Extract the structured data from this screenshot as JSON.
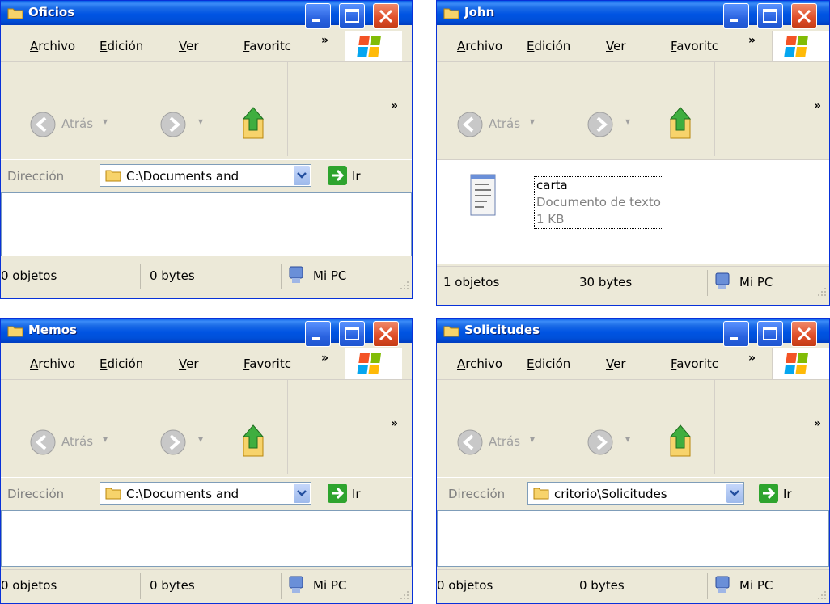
{
  "windows": [
    {
      "title": "Oficios",
      "menu": [
        "Archivo",
        "Edición",
        "Ver",
        "Favoritc"
      ],
      "menu_underline": [
        "A",
        "E",
        "V",
        "F"
      ],
      "back_label": "Atrás",
      "address_label": "Dirección",
      "address_value": "C:\\Documents and",
      "go_label": "Ir",
      "status_objects": "0 objetos",
      "status_bytes": "0 bytes",
      "status_location": "Mi PC",
      "files": []
    },
    {
      "title": "John",
      "menu": [
        "Archivo",
        "Edición",
        "Ver",
        "Favoritc"
      ],
      "menu_underline": [
        "A",
        "E",
        "V",
        "F"
      ],
      "back_label": "Atrás",
      "address_label": "",
      "address_value": "",
      "go_label": "",
      "status_objects": "1 objetos",
      "status_bytes": "30 bytes",
      "status_location": "Mi PC",
      "files": [
        {
          "name": "carta",
          "type": "Documento de texto",
          "size": "1 KB",
          "icon": "notepad-document-icon"
        }
      ]
    },
    {
      "title": "Memos",
      "menu": [
        "Archivo",
        "Edición",
        "Ver",
        "Favoritc"
      ],
      "menu_underline": [
        "A",
        "E",
        "V",
        "F"
      ],
      "back_label": "Atrás",
      "address_label": "Dirección",
      "address_value": "C:\\Documents and",
      "go_label": "Ir",
      "status_objects": "0 objetos",
      "status_bytes": "0 bytes",
      "status_location": "Mi PC",
      "files": []
    },
    {
      "title": "Solicitudes",
      "menu": [
        "Archivo",
        "Edición",
        "Ver",
        "Favoritc"
      ],
      "menu_underline": [
        "A",
        "E",
        "V",
        "F"
      ],
      "back_label": "Atrás",
      "address_label": "Dirección",
      "address_value": "critorio\\Solicitudes",
      "go_label": "Ir",
      "status_objects": "0 objetos",
      "status_bytes": "0 bytes",
      "status_location": "Mi PC",
      "files": []
    }
  ],
  "colors": {
    "titlebar": "#0054e3",
    "close_button": "#e0502b",
    "window_body": "#ece9d8",
    "content_bg": "#ffffff",
    "folder": "#f7d36b",
    "go_arrow": "#2ea42e"
  }
}
